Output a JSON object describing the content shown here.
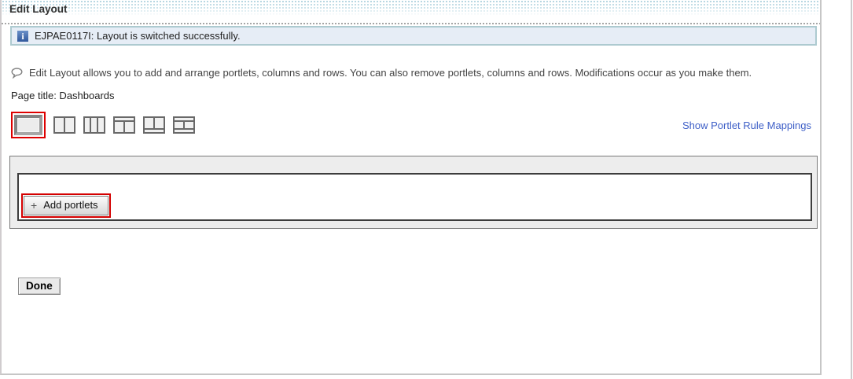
{
  "window": {
    "title": "Edit Layout"
  },
  "info_message": {
    "icon": "info-icon",
    "text": "EJPAE0117I: Layout is switched successfully."
  },
  "help": {
    "icon": "comment-bubble-icon",
    "text": "Edit Layout allows you to add and arrange portlets, columns and rows. You can also remove portlets, columns and rows. Modifications occur as you make them."
  },
  "page_title_line": "Page title: Dashboards",
  "layout_selector": {
    "options": [
      {
        "name": "one-column",
        "selected": true
      },
      {
        "name": "two-columns",
        "selected": false
      },
      {
        "name": "three-columns",
        "selected": false
      },
      {
        "name": "header-with-two-columns",
        "selected": false
      },
      {
        "name": "two-columns-with-footer",
        "selected": false
      },
      {
        "name": "header-two-columns-footer",
        "selected": false
      }
    ]
  },
  "show_portlet_rule_mappings_link": "Show Portlet Rule Mappings",
  "add_portlets_button": {
    "plus": "+",
    "label": "Add portlets"
  },
  "done_button_label": "Done",
  "colors": {
    "annotation_highlight_red": "#dd0000",
    "link_blue": "#3e5fc7",
    "info_bar_bg": "#e6edf6",
    "info_bar_border": "#adcad0",
    "info_icon_blue": "#30589c",
    "canvas_gray": "#ededed"
  }
}
